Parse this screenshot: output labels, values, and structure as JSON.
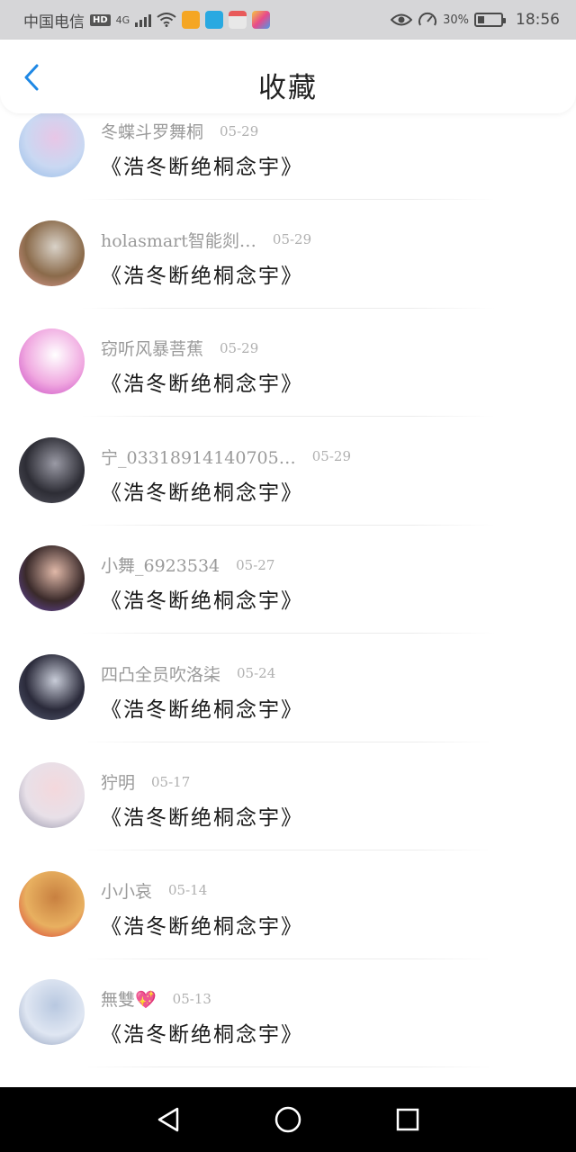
{
  "status_bar": {
    "carrier": "中国电信",
    "hd": "HD",
    "network": "4G",
    "battery_percent": "30%",
    "battery_level": 0.3,
    "time": "18:56",
    "icons": [
      "signal-icon",
      "wifi-icon",
      "eye-icon",
      "speed-icon",
      "battery-icon"
    ]
  },
  "header": {
    "title": "收藏",
    "back_icon": "chevron-left-icon",
    "accent": "#1e88e5"
  },
  "items": [
    {
      "name": "冬蝶斗罗舞桐",
      "date": "05-29",
      "title": "《浩冬断绝桐念宇》",
      "avatar_colors": [
        "#c9d8f2",
        "#e8c6e6",
        "#8fb8e6"
      ]
    },
    {
      "name": "holasmart智能剡…",
      "date": "05-29",
      "title": "《浩冬断绝桐念宇》",
      "avatar_colors": [
        "#8a6a4a",
        "#d9d2c8",
        "#e6a29a"
      ]
    },
    {
      "name": "窃听风暴菩蕉",
      "date": "05-29",
      "title": "《浩冬断绝桐念宇》",
      "avatar_colors": [
        "#f0a8e0",
        "#ffffff",
        "#c43fbf"
      ]
    },
    {
      "name": "宁_03318914140705…",
      "date": "05-29",
      "title": "《浩冬断绝桐念宇》",
      "avatar_colors": [
        "#2d2d35",
        "#9a9aa5",
        "#5a5a65"
      ]
    },
    {
      "name": "小舞_6923534",
      "date": "05-27",
      "title": "《浩冬断绝桐念宇》",
      "avatar_colors": [
        "#3a2a2a",
        "#e0b8a8",
        "#6a4ab8"
      ]
    },
    {
      "name": "四凸全员吹洛柒",
      "date": "05-24",
      "title": "《浩冬断绝桐念宇》",
      "avatar_colors": [
        "#2a2a3a",
        "#c8ccd8",
        "#5a6078"
      ]
    },
    {
      "name": "狞明",
      "date": "05-17",
      "title": "《浩冬断绝桐念宇》",
      "avatar_colors": [
        "#e8e0e8",
        "#f4d8dc",
        "#8888a0"
      ]
    },
    {
      "name": "小小哀",
      "date": "05-14",
      "title": "《浩冬断绝桐念宇》",
      "avatar_colors": [
        "#e8b060",
        "#c88040",
        "#d83030"
      ]
    },
    {
      "name": "無雙💖",
      "date": "05-13",
      "title": "《浩冬断绝桐念宇》",
      "avatar_colors": [
        "#dfe6f2",
        "#b8c8e0",
        "#8898b8"
      ]
    }
  ],
  "nav_bar": {
    "icons": [
      "back-triangle-icon",
      "home-circle-icon",
      "recents-square-icon"
    ]
  }
}
